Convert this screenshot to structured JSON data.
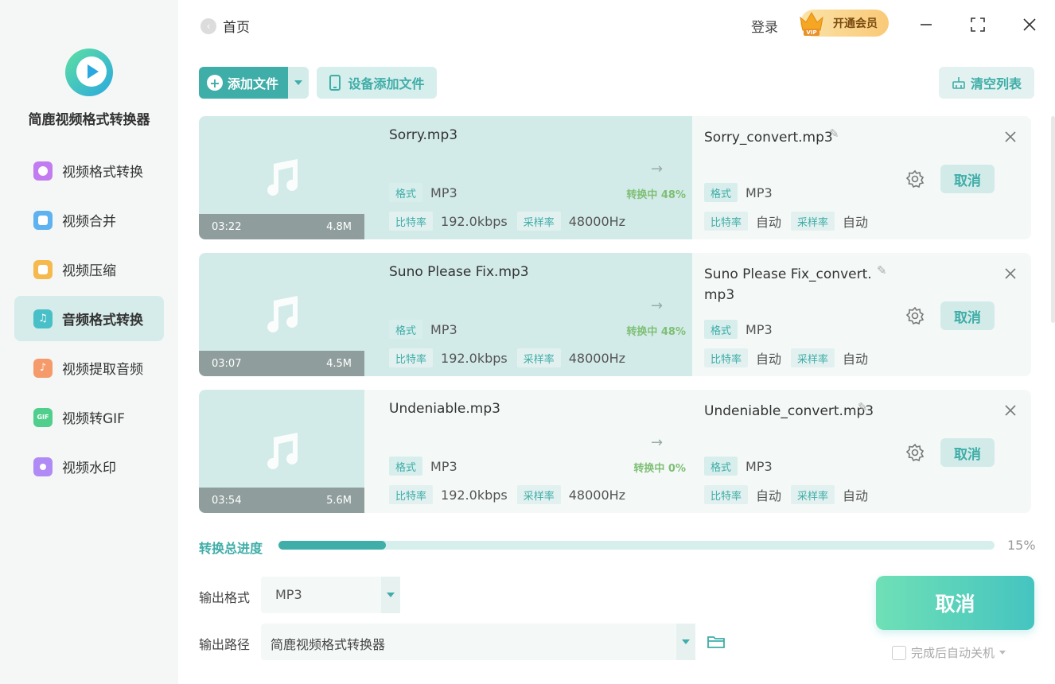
{
  "app": {
    "name": "简鹿视频格式转换器",
    "brand_color": "#3fada8"
  },
  "sidebar": {
    "items": [
      {
        "label": "视频格式转换",
        "icon": "video-convert-icon",
        "color": "#c27cf0",
        "active": false
      },
      {
        "label": "视频合并",
        "icon": "video-merge-icon",
        "color": "#5fb2f0",
        "active": false
      },
      {
        "label": "视频压缩",
        "icon": "video-compress-icon",
        "color": "#f5b94d",
        "active": false
      },
      {
        "label": "音频格式转换",
        "icon": "audio-convert-icon",
        "color": "#49c0c7",
        "active": true
      },
      {
        "label": "视频提取音频",
        "icon": "extract-audio-icon",
        "color": "#f59a6a",
        "active": false
      },
      {
        "label": "视频转GIF",
        "icon": "gif-icon",
        "color": "#4fcf8b",
        "active": false
      },
      {
        "label": "视频水印",
        "icon": "watermark-icon",
        "color": "#b08af5",
        "active": false
      }
    ]
  },
  "header": {
    "back_label": "首页",
    "login_label": "登录",
    "vip_label": "开通会员"
  },
  "toolbar": {
    "add_file_label": "添加文件",
    "device_add_label": "设备添加文件",
    "clear_list_label": "清空列表"
  },
  "files": [
    {
      "name": "Sorry.mp3",
      "duration": "03:22",
      "size": "4.8M",
      "format_tag": "格式",
      "format": "MP3",
      "bitrate_tag": "比特率",
      "bitrate": "192.0kbps",
      "samplerate_tag": "采样率",
      "samplerate": "48000Hz",
      "status": "转换中 48%",
      "progress": 48,
      "output_name": "Sorry_convert.mp3",
      "output_format": "MP3",
      "output_bitrate": "自动",
      "output_samplerate": "自动",
      "cancel_label": "取消"
    },
    {
      "name": "Suno Please Fix.mp3",
      "duration": "03:07",
      "size": "4.5M",
      "format_tag": "格式",
      "format": "MP3",
      "bitrate_tag": "比特率",
      "bitrate": "192.0kbps",
      "samplerate_tag": "采样率",
      "samplerate": "48000Hz",
      "status": "转换中 48%",
      "progress": 48,
      "output_name": "Suno Please Fix_convert.mp3",
      "output_format": "MP3",
      "output_bitrate": "自动",
      "output_samplerate": "自动",
      "cancel_label": "取消"
    },
    {
      "name": "Undeniable.mp3",
      "duration": "03:54",
      "size": "5.6M",
      "format_tag": "格式",
      "format": "MP3",
      "bitrate_tag": "比特率",
      "bitrate": "192.0kbps",
      "samplerate_tag": "采样率",
      "samplerate": "48000Hz",
      "status": "转换中 0%",
      "progress": 0,
      "output_name": "Undeniable_convert.mp3",
      "output_format": "MP3",
      "output_bitrate": "自动",
      "output_samplerate": "自动",
      "cancel_label": "取消"
    }
  ],
  "progress": {
    "label": "转换总进度",
    "percent_text": "15%",
    "percent": 15
  },
  "output": {
    "format_label": "输出格式",
    "format_value": "MP3",
    "path_label": "输出路径",
    "path_value": "简鹿视频格式转换器"
  },
  "footer": {
    "cancel_all_label": "取消",
    "auto_shutdown_label": "完成后自动关机"
  }
}
